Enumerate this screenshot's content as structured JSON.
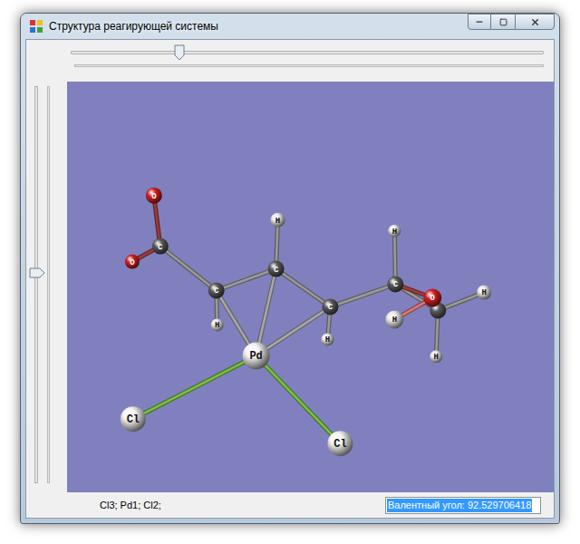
{
  "window": {
    "title": "Структура реагирующей системы"
  },
  "horizontal_slider": {
    "level": 0.23
  },
  "vertical_slider": {
    "level": 0.47
  },
  "molecule": {
    "atoms": [
      {
        "label": "O",
        "color": "#d42020"
      },
      {
        "label": "O",
        "color": "#d42020"
      },
      {
        "label": "C",
        "color": "#5a5a5a"
      },
      {
        "label": "C",
        "color": "#5a5a5a"
      },
      {
        "label": "H",
        "color": "#e8e8e8"
      },
      {
        "label": "C",
        "color": "#5a5a5a"
      },
      {
        "label": "H",
        "color": "#e8e8e8"
      },
      {
        "label": "C",
        "color": "#5a5a5a"
      },
      {
        "label": "H",
        "color": "#e8e8e8"
      },
      {
        "label": "C",
        "color": "#5a5a5a"
      },
      {
        "label": "H",
        "color": "#e8e8e8"
      },
      {
        "label": "",
        "color": "#5a5a5a"
      },
      {
        "label": "O",
        "color": "#d42020"
      },
      {
        "label": "H",
        "color": "#e8e8e8"
      },
      {
        "label": "H",
        "color": "#e8e8e8"
      },
      {
        "label": "H",
        "color": "#e8e8e8"
      },
      {
        "label": "Pd",
        "color": "#f2f2f2"
      },
      {
        "label": "Cl",
        "color": "#f2f2f2"
      },
      {
        "label": "Cl",
        "color": "#f2f2f2"
      }
    ],
    "bonds": [
      {
        "from": 0,
        "to": 2,
        "color": "#a03a3a"
      },
      {
        "from": 1,
        "to": 2,
        "color": "#a03a3a"
      },
      {
        "from": 2,
        "to": 3,
        "color": "#9a9a9a"
      },
      {
        "from": 3,
        "to": 4,
        "color": "#9a9a9a"
      },
      {
        "from": 3,
        "to": 5,
        "color": "#9a9a9a"
      },
      {
        "from": 5,
        "to": 6,
        "color": "#9a9a9a"
      },
      {
        "from": 5,
        "to": 7,
        "color": "#9a9a9a"
      },
      {
        "from": 7,
        "to": 8,
        "color": "#9a9a9a"
      },
      {
        "from": 7,
        "to": 9,
        "color": "#9a9a9a"
      },
      {
        "from": 9,
        "to": 10,
        "color": "#9a9a9a"
      },
      {
        "from": 9,
        "to": 11,
        "color": "#9a9a9a"
      },
      {
        "from": 11,
        "to": 14,
        "color": "#9a9a9a"
      },
      {
        "from": 11,
        "to": 15,
        "color": "#9a9a9a"
      },
      {
        "from": 9,
        "to": 12,
        "color": "#a03a3a"
      },
      {
        "from": 12,
        "to": 13,
        "color": "#e07878"
      },
      {
        "from": 16,
        "to": 3,
        "color": "#a8a8a8"
      },
      {
        "from": 16,
        "to": 5,
        "color": "#a8a8a8"
      },
      {
        "from": 16,
        "to": 7,
        "color": "#a8a8a8"
      },
      {
        "from": 16,
        "to": 17,
        "color": "#7ac142"
      },
      {
        "from": 16,
        "to": 18,
        "color": "#7ac142"
      }
    ]
  },
  "status_bar": {
    "selection": "Cl3; Pd1; Cl2;",
    "angle_field": {
      "value": "Валентный угол: 92.529706418",
      "selected": true
    }
  }
}
